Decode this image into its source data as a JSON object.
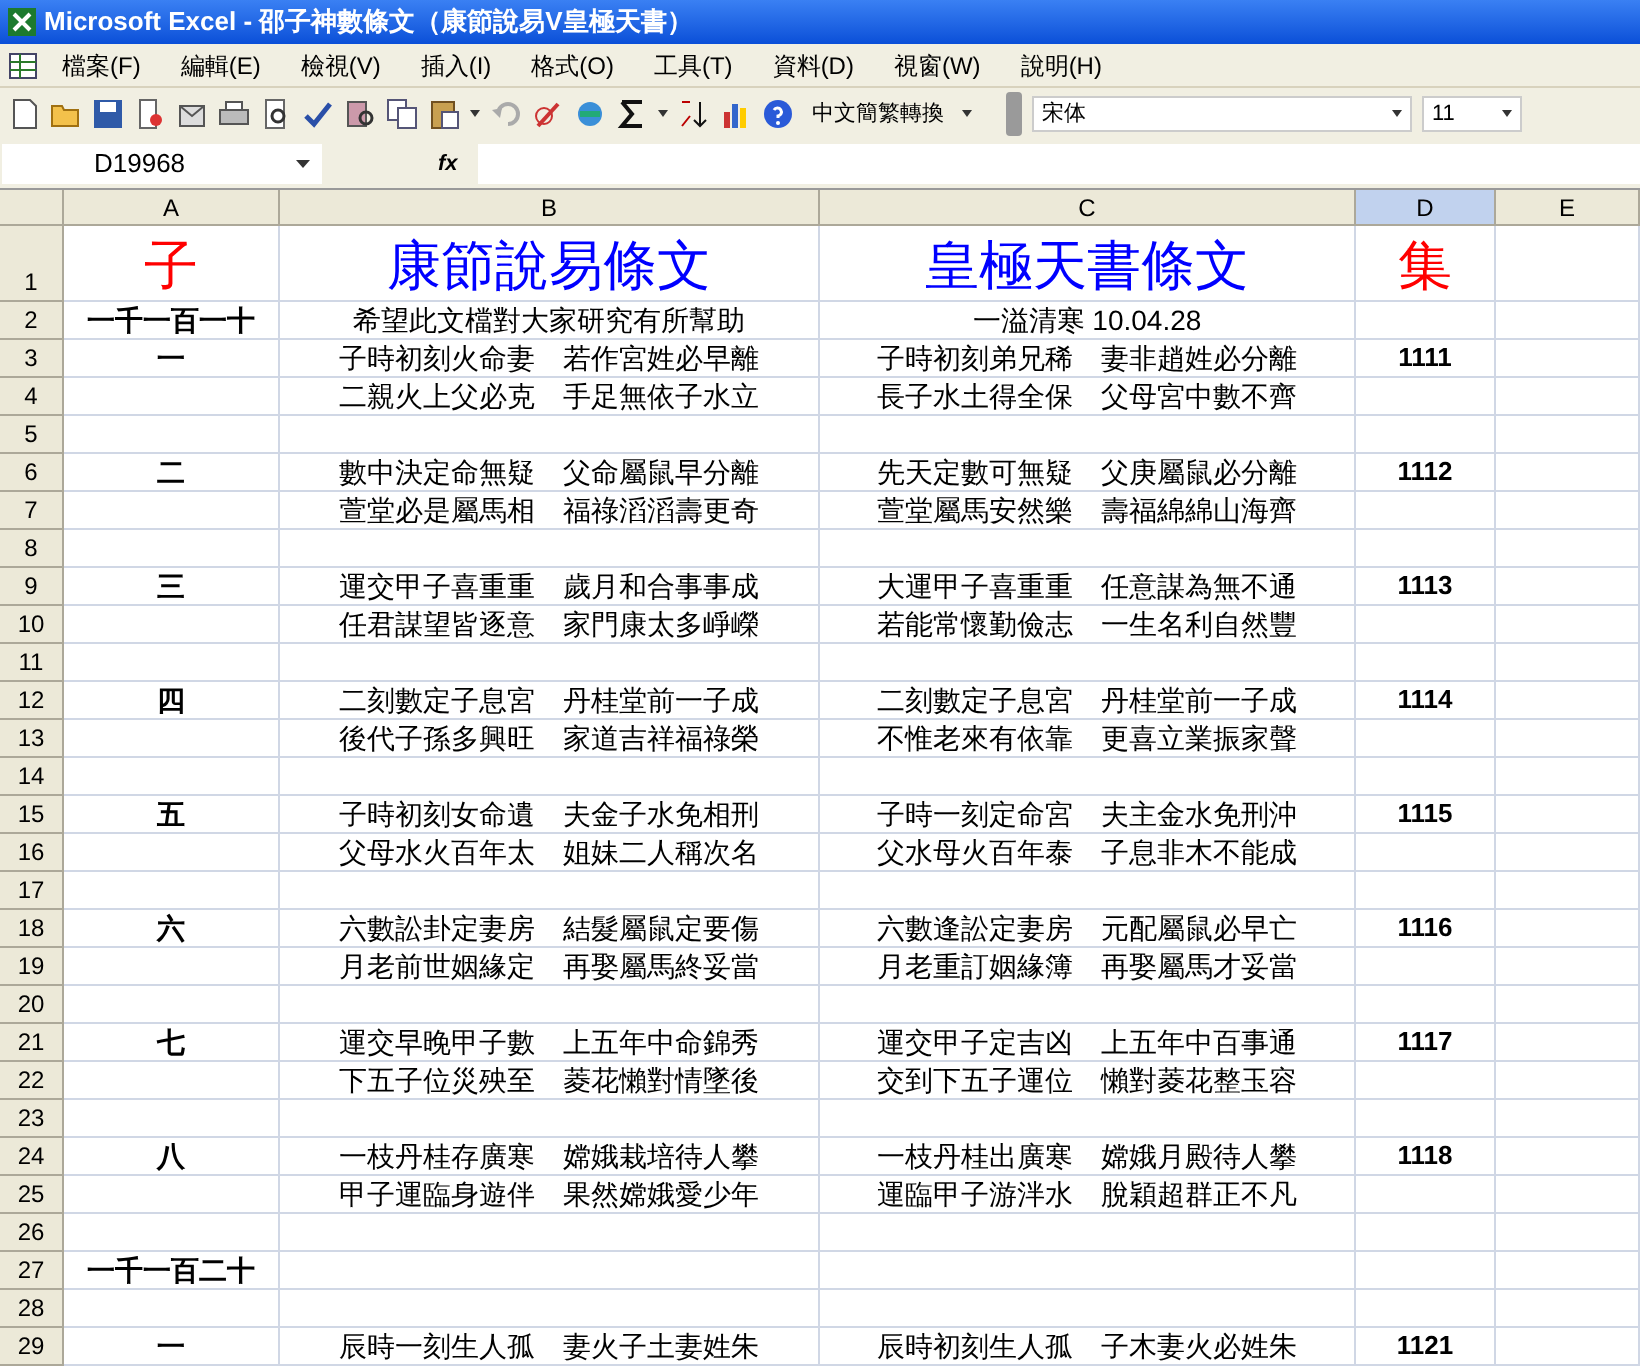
{
  "window": {
    "title": "Microsoft Excel - 邵子神數條文（康節說易V皇極天書）"
  },
  "menu": [
    "檔案(F)",
    "編輯(E)",
    "檢視(V)",
    "插入(I)",
    "格式(O)",
    "工具(T)",
    "資料(D)",
    "視窗(W)",
    "說明(H)"
  ],
  "toolbar": {
    "convert_label": "中文簡繁轉換",
    "font": "宋体",
    "size": "11"
  },
  "formula_bar": {
    "name_box": "D19968",
    "fx": "fx"
  },
  "columns": [
    {
      "label": "A",
      "selected": false
    },
    {
      "label": "B",
      "selected": false
    },
    {
      "label": "C",
      "selected": false
    },
    {
      "label": "D",
      "selected": true
    },
    {
      "label": "E",
      "selected": false
    }
  ],
  "rows": [
    {
      "num": "1",
      "kind": "title",
      "cells": [
        {
          "text": "子",
          "color": "#ff0000"
        },
        {
          "text": "康節說易條文",
          "color": "#0000ff"
        },
        {
          "text": "皇極天書條文",
          "color": "#0000ff"
        },
        {
          "text": "集",
          "color": "#ff0000"
        }
      ]
    },
    {
      "num": "2",
      "kind": "data",
      "a": "一千一百一十",
      "b": "希望此文檔對大家研究有所幫助",
      "c": "一溢清寒 10.04.28",
      "d": ""
    },
    {
      "num": "3",
      "kind": "data",
      "a": "一",
      "b": "子時初刻火命妻　若作宮姓必早離",
      "c": "子時初刻弟兄稀　妻非趙姓必分離",
      "d": "1111"
    },
    {
      "num": "4",
      "kind": "data",
      "a": "",
      "b": "二親火上父必克　手足無依子水立",
      "c": "長子水土得全保　父母宮中數不齊",
      "d": ""
    },
    {
      "num": "5",
      "kind": "data",
      "a": "",
      "b": "",
      "c": "",
      "d": ""
    },
    {
      "num": "6",
      "kind": "data",
      "a": "二",
      "b": "數中決定命無疑　父命屬鼠早分離",
      "c": "先天定數可無疑　父庚屬鼠必分離",
      "d": "1112"
    },
    {
      "num": "7",
      "kind": "data",
      "a": "",
      "b": "萱堂必是屬馬相　福祿滔滔壽更奇",
      "c": "萱堂屬馬安然樂　壽福綿綿山海齊",
      "d": ""
    },
    {
      "num": "8",
      "kind": "data",
      "a": "",
      "b": "",
      "c": "",
      "d": ""
    },
    {
      "num": "9",
      "kind": "data",
      "a": "三",
      "b": "運交甲子喜重重　歲月和合事事成",
      "c": "大運甲子喜重重　任意謀為無不通",
      "d": "1113"
    },
    {
      "num": "10",
      "kind": "data",
      "a": "",
      "b": "任君謀望皆逐意　家門康太多崢嶸",
      "c": "若能常懷勤儉志　一生名利自然豐",
      "d": ""
    },
    {
      "num": "11",
      "kind": "data",
      "a": "",
      "b": "",
      "c": "",
      "d": ""
    },
    {
      "num": "12",
      "kind": "data",
      "a": "四",
      "b": "二刻數定子息宮　丹桂堂前一子成",
      "c": "二刻數定子息宮　丹桂堂前一子成",
      "d": "1114"
    },
    {
      "num": "13",
      "kind": "data",
      "a": "",
      "b": "後代子孫多興旺　家道吉祥福祿榮",
      "c": "不惟老來有依靠　更喜立業振家聲",
      "d": ""
    },
    {
      "num": "14",
      "kind": "data",
      "a": "",
      "b": "",
      "c": "",
      "d": ""
    },
    {
      "num": "15",
      "kind": "data",
      "a": "五",
      "b": "子時初刻女命遺　夫金子水免相刑",
      "c": "子時一刻定命宮　夫主金水免刑沖",
      "d": "1115"
    },
    {
      "num": "16",
      "kind": "data",
      "a": "",
      "b": "父母水火百年太　姐妹二人稱次名",
      "c": "父水母火百年泰　子息非木不能成",
      "d": ""
    },
    {
      "num": "17",
      "kind": "data",
      "a": "",
      "b": "",
      "c": "",
      "d": ""
    },
    {
      "num": "18",
      "kind": "data",
      "a": "六",
      "b": "六數訟卦定妻房　結髮屬鼠定要傷",
      "c": "六數逢訟定妻房　元配屬鼠必早亡",
      "d": "1116"
    },
    {
      "num": "19",
      "kind": "data",
      "a": "",
      "b": "月老前世姻緣定　再娶屬馬終妥當",
      "c": "月老重訂姻緣簿　再娶屬馬才妥當",
      "d": ""
    },
    {
      "num": "20",
      "kind": "data",
      "a": "",
      "b": "",
      "c": "",
      "d": ""
    },
    {
      "num": "21",
      "kind": "data",
      "a": "七",
      "b": "運交早晚甲子數　上五年中命錦秀",
      "c": "運交甲子定吉凶　上五年中百事通",
      "d": "1117"
    },
    {
      "num": "22",
      "kind": "data",
      "a": "",
      "b": "下五子位災殃至　菱花懶對情墜後",
      "c": "交到下五子運位　懶對菱花整玉容",
      "d": ""
    },
    {
      "num": "23",
      "kind": "data",
      "a": "",
      "b": "",
      "c": "",
      "d": ""
    },
    {
      "num": "24",
      "kind": "data",
      "a": "八",
      "b": "一枝丹桂存廣寒　嫦娥栽培待人攀",
      "c": "一枝丹桂出廣寒　嫦娥月殿待人攀",
      "d": "1118"
    },
    {
      "num": "25",
      "kind": "data",
      "a": "",
      "b": "甲子運臨身遊伴　果然嫦娥愛少年",
      "c": "運臨甲子游泮水　脫穎超群正不凡",
      "d": ""
    },
    {
      "num": "26",
      "kind": "data",
      "a": "",
      "b": "",
      "c": "",
      "d": ""
    },
    {
      "num": "27",
      "kind": "data",
      "a": "一千一百二十",
      "b": "",
      "c": "",
      "d": ""
    },
    {
      "num": "28",
      "kind": "data",
      "a": "",
      "b": "",
      "c": "",
      "d": ""
    },
    {
      "num": "29",
      "kind": "data",
      "a": "一",
      "b": "辰時一刻生人孤　妻火子土妻姓朱",
      "c": "辰時初刻生人孤　子木妻火必姓朱",
      "d": "1121"
    }
  ]
}
